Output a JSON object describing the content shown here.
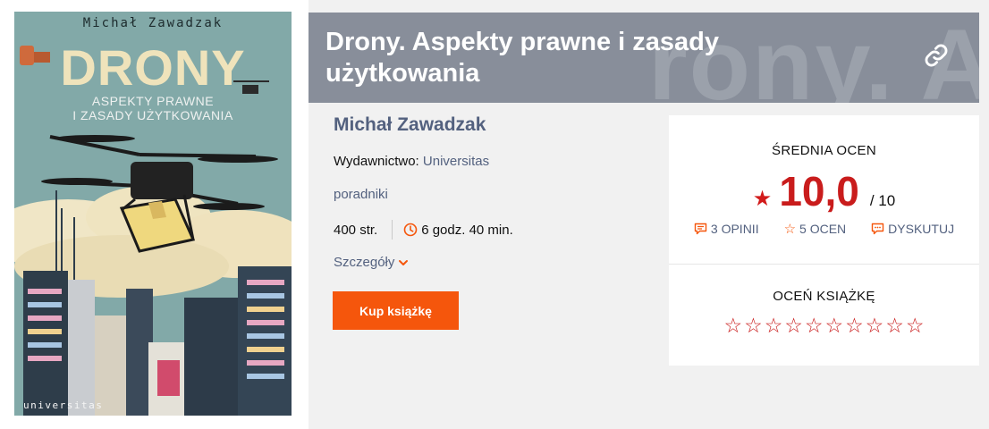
{
  "cover": {
    "author": "Michał Zawadzak",
    "title": "DRONY",
    "subtitle": "ASPEKTY PRAWNE\nI ZASADY UŻYTKOWANIA",
    "publisher": "universitas"
  },
  "header": {
    "title": "Drony. Aspekty prawne i zasady użytkowania",
    "watermark": "rony. Aspe",
    "link_icon": "link-icon"
  },
  "book": {
    "author": "Michał Zawadzak",
    "publisher_label": "Wydawnictwo:",
    "publisher": "Universitas",
    "category": "poradniki",
    "pages": "400 str.",
    "reading_time": "6 godz. 40 min.",
    "details_label": "Szczegóły",
    "buy_label": "Kup książkę"
  },
  "rating": {
    "average_label": "ŚREDNIA OCEN",
    "average": "10,0",
    "max": "/ 10",
    "opinions": "3 OPINII",
    "ratings": "5 OCEN",
    "discuss": "DYSKUTUJ",
    "rate_label": "OCEŃ KSIĄŻKĘ",
    "star_count": 10
  },
  "colors": {
    "accent": "#f5560c",
    "rating_red": "#c91c1c",
    "link": "#53617f",
    "title_bar": "#888e9a"
  }
}
